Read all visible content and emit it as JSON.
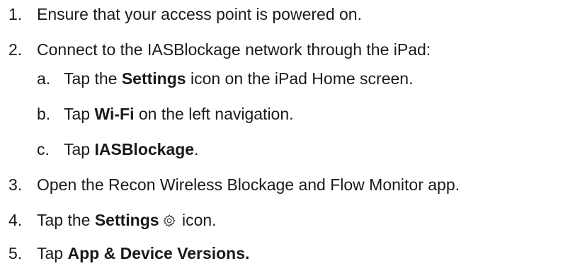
{
  "steps": [
    {
      "num": "1.",
      "text": "Ensure that your access point is powered on."
    },
    {
      "num": "2.",
      "text": "Connect to the IASBlockage network through the iPad:"
    },
    {
      "num": "3.",
      "text": "Open the Recon Wireless Blockage and Flow Monitor app."
    },
    {
      "num": "4.",
      "pre": "Tap the ",
      "bold": "Settings",
      "post": " icon.",
      "icon": "settings-gear-icon"
    },
    {
      "num": "5.",
      "pre": "Tap ",
      "bold": "App & Device Versions."
    }
  ],
  "substeps": [
    {
      "num": "a.",
      "pre": "Tap the ",
      "bold": "Settings",
      "post": " icon on the iPad Home screen."
    },
    {
      "num": "b.",
      "pre": "Tap ",
      "bold": "Wi-Fi",
      "post": " on the left navigation."
    },
    {
      "num": "c.",
      "pre": "Tap ",
      "bold": "IASBlockage",
      "post": "."
    }
  ]
}
